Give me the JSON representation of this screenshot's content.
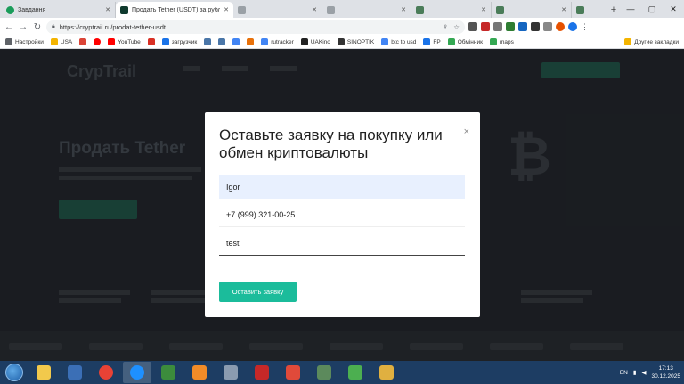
{
  "browser": {
    "tabs": [
      {
        "label": "Завдання",
        "icon": "green-circle-icon",
        "color": "#1a9c5a"
      },
      {
        "label": "Продать Tether (USDT) за рубли",
        "icon": "cryptrail-icon",
        "color": "#0f3a2e"
      },
      {
        "label": "",
        "icon": "page-icon",
        "color": "#9aa0a6"
      },
      {
        "label": "",
        "icon": "page-icon",
        "color": "#9aa0a6"
      },
      {
        "label": "",
        "icon": "page-icon",
        "color": "#4a7c59"
      },
      {
        "label": "",
        "icon": "page-icon",
        "color": "#4a7c59"
      },
      {
        "label": "",
        "icon": "page-icon",
        "color": "#4a7c59"
      }
    ],
    "url": "https://cryptrail.ru/prodat-tether-usdt"
  },
  "bookmarks": [
    {
      "label": "Настройки",
      "icon": "gear-icon",
      "color": "#5f6368"
    },
    {
      "label": "USA",
      "icon": "folder-icon",
      "color": "#f4b400"
    },
    {
      "label": "",
      "icon": "google-icon",
      "color": "#db4437"
    },
    {
      "label": "",
      "icon": "yandex-icon",
      "color": "#ff0000"
    },
    {
      "label": "YouTube",
      "icon": "youtube-icon",
      "color": "#ff0000"
    },
    {
      "label": "",
      "icon": "gmail-icon",
      "color": "#d93025"
    },
    {
      "label": "загрузчик",
      "icon": "download-icon",
      "color": "#1a73e8"
    },
    {
      "label": "",
      "icon": "vk-icon",
      "color": "#4a76a8"
    },
    {
      "label": "",
      "icon": "vk-icon",
      "color": "#4a76a8"
    },
    {
      "label": "",
      "icon": "google-icon",
      "color": "#4285f4"
    },
    {
      "label": "",
      "icon": "f-icon",
      "color": "#e8710a"
    },
    {
      "label": "rutracker",
      "icon": "rutracker-icon",
      "color": "#4285f4"
    },
    {
      "label": "UAKino",
      "icon": "uakino-icon",
      "color": "#222222"
    },
    {
      "label": "SINOPTIK",
      "icon": "sinoptik-icon",
      "color": "#333333"
    },
    {
      "label": "btc to usd",
      "icon": "google-icon",
      "color": "#4285f4"
    },
    {
      "label": "FP",
      "icon": "fp-icon",
      "color": "#1a73e8"
    },
    {
      "label": "Обмінник",
      "icon": "exchanger-icon",
      "color": "#34a853"
    },
    {
      "label": "maps",
      "icon": "maps-icon",
      "color": "#34a853"
    }
  ],
  "bookmarks_other": "Другие закладки",
  "site": {
    "logo": "CrypTrail",
    "hero_title": "Продать Tether"
  },
  "modal": {
    "title": "Оставьте заявку на покупку или обмен криптовалюты",
    "close": "×",
    "fields": {
      "name": "Igor",
      "phone": "+7 (999) 321-00-25",
      "comment": "test"
    },
    "submit": "Оставить заявку"
  },
  "taskbar": {
    "apps": [
      {
        "icon": "explorer-icon",
        "color": "#f2c94c"
      },
      {
        "icon": "word-icon",
        "color": "#3b6fb6"
      },
      {
        "icon": "chrome-icon",
        "color": "#e94235"
      },
      {
        "icon": "ie-icon",
        "color": "#1e90ff"
      },
      {
        "icon": "terminal-icon",
        "color": "#3c8c3c"
      },
      {
        "icon": "media-player-icon",
        "color": "#f28c28"
      },
      {
        "icon": "shield-icon",
        "color": "#8a9bb0"
      },
      {
        "icon": "aida64-icon",
        "color": "#c62828"
      },
      {
        "icon": "paint-icon",
        "color": "#e04a3a"
      },
      {
        "icon": "app-icon",
        "color": "#5c8a5c"
      },
      {
        "icon": "monitor-icon",
        "color": "#4caf50"
      },
      {
        "icon": "folder-icon",
        "color": "#e0b040"
      }
    ],
    "lang": "EN",
    "time": "17:13",
    "date": "30.12.2025"
  }
}
